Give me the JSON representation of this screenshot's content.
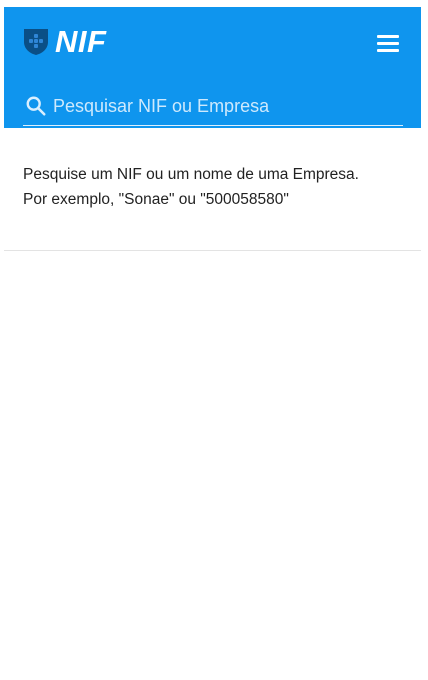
{
  "header": {
    "logo_text": "NIF",
    "logo_icon": "shield-icon",
    "menu_icon": "hamburger-menu-icon",
    "background_color": "#0f95ee"
  },
  "search": {
    "placeholder": "Pesquisar NIF ou Empresa",
    "value": "",
    "icon": "search-icon"
  },
  "content": {
    "hint_line_1": "Pesquise um NIF ou um nome de uma Empresa.",
    "hint_line_2": "Por exemplo, \"Sonae\" ou \"500058580\""
  }
}
